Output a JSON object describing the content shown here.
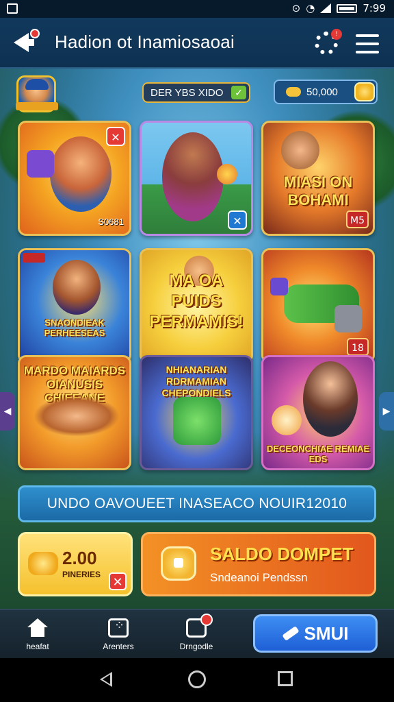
{
  "status_bar": {
    "time": "7:99"
  },
  "header": {
    "title": "Hadion ot Inamiosaoai"
  },
  "top_row": {
    "left_pill": "DER YBS XIDO",
    "right_pill": "50,000"
  },
  "cards": [
    {
      "title": "",
      "price": "S0681",
      "badge": ""
    },
    {
      "title": "",
      "badge": "✕"
    },
    {
      "title": "MIASI ON BOHAMI",
      "badge": "M5"
    },
    {
      "title": "SNAONDIEAK PERHEESEAS",
      "tag": "",
      "badge": ""
    },
    {
      "title": "MA OA PUIDS PERMAMIS!"
    },
    {
      "title": "",
      "badge": "18"
    },
    {
      "title": "MARDO MAIARDS OIANUSIS CHIEEANE"
    },
    {
      "title": "NHIANARIAN RDRMAMIAN CHEPONDIELS"
    },
    {
      "title": "DECEONCHIAE REMIAE EDS"
    }
  ],
  "banner": {
    "text": "UNDO OAVOUEET INASEACO NOUIR12010"
  },
  "promo_left": {
    "value": "2.00",
    "label": "PINERIES"
  },
  "promo_right": {
    "title": "SALDO DOMPET",
    "subtitle": "Sndeanoi Pendssn"
  },
  "tabbar": {
    "items": [
      {
        "label": "heafat"
      },
      {
        "label": "Arenters"
      },
      {
        "label": "Drngodle"
      }
    ],
    "cta": "SMUI"
  }
}
